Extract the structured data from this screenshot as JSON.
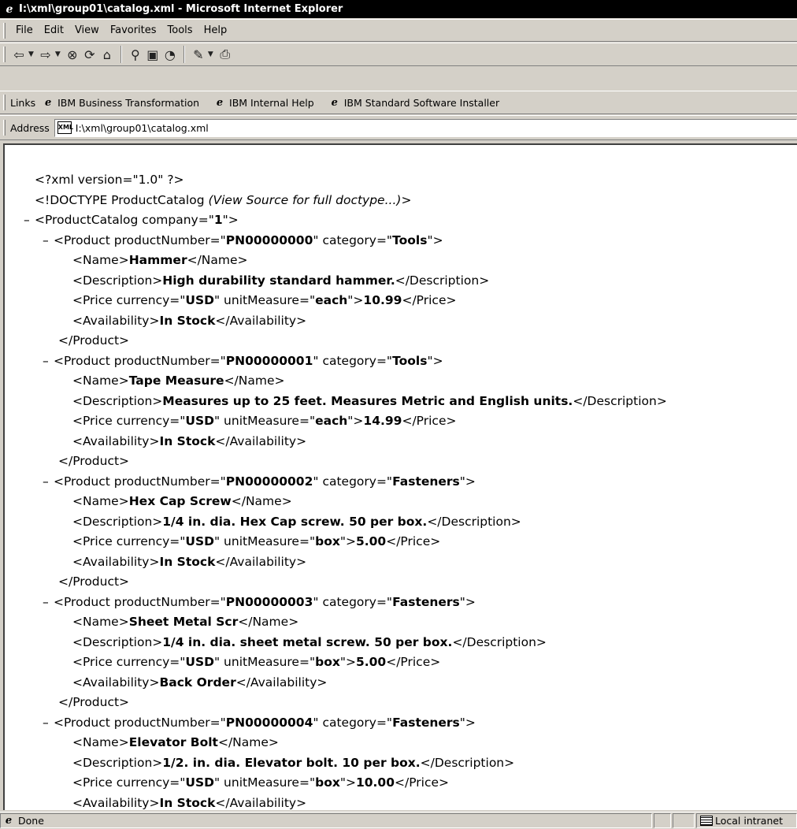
{
  "window": {
    "title": "I:\\xml\\group01\\catalog.xml - Microsoft Internet Explorer"
  },
  "menu": [
    "File",
    "Edit",
    "View",
    "Favorites",
    "Tools",
    "Help"
  ],
  "toolbar": {
    "buttons": [
      "back-icon",
      "forward-icon",
      "stop-icon",
      "refresh-icon",
      "home-icon",
      "search-icon",
      "favorites-icon",
      "history-icon",
      "edit-icon",
      "print-icon"
    ]
  },
  "links": {
    "label": "Links",
    "items": [
      "IBM Business Transformation",
      "IBM Internal Help",
      "IBM Standard Software Installer"
    ]
  },
  "address": {
    "label": "Address",
    "value": "I:\\xml\\group01\\catalog.xml"
  },
  "xml": {
    "decl": "<?xml version=\"1.0\" ?>",
    "doctype_open": "<!DOCTYPE ProductCatalog ",
    "doctype_note": "(View Source for full doctype...)",
    "doctype_close": ">",
    "toggle": "–",
    "catalog": {
      "open_start": "<ProductCatalog company=\"",
      "company": "1",
      "open_end": "\">"
    },
    "products": [
      {
        "number": "PN00000000",
        "category": "Tools",
        "name": "Hammer",
        "description": "High durability standard hammer.",
        "currency": "USD",
        "unit": "each",
        "price": "10.99",
        "availability": "In Stock",
        "closed": true
      },
      {
        "number": "PN00000001",
        "category": "Tools",
        "name": "Tape Measure",
        "description": "Measures up to 25 feet. Measures Metric and English units.",
        "currency": "USD",
        "unit": "each",
        "price": "14.99",
        "availability": "In Stock",
        "closed": true
      },
      {
        "number": "PN00000002",
        "category": "Fasteners",
        "name": "Hex Cap Screw",
        "description": "1/4 in. dia. Hex Cap screw. 50 per box.",
        "currency": "USD",
        "unit": "box",
        "price": "5.00",
        "availability": "In Stock",
        "closed": true
      },
      {
        "number": "PN00000003",
        "category": "Fasteners",
        "name": "Sheet Metal Scr",
        "description": "1/4 in. dia. sheet metal screw. 50 per box.",
        "currency": "USD",
        "unit": "box",
        "price": "5.00",
        "availability": "Back Order",
        "closed": true
      },
      {
        "number": "PN00000004",
        "category": "Fasteners",
        "name": "Elevator Bolt",
        "description": "1/2. in. dia. Elevator bolt. 10 per box.",
        "currency": "USD",
        "unit": "box",
        "price": "10.00",
        "availability": "In Stock",
        "closed": false
      }
    ],
    "syntax": {
      "product_open_a": "<Product productNumber=\"",
      "product_open_b": "\" category=\"",
      "product_open_c": "\">",
      "name_open": "<Name>",
      "name_close": "</Name>",
      "desc_open": "<Description>",
      "desc_close": "</Description>",
      "price_open_a": "<Price currency=\"",
      "price_open_b": "\" unitMeasure=\"",
      "price_open_c": "\">",
      "price_close": "</Price>",
      "avail_open": "<Availability>",
      "avail_close": "</Availability>",
      "product_close": "</Product>"
    }
  },
  "status": {
    "text": "Done",
    "zone": "Local intranet"
  }
}
